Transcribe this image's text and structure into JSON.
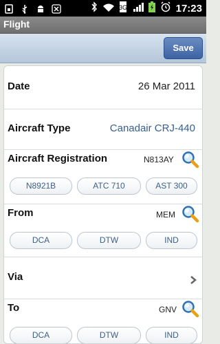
{
  "status_bar": {
    "time": "17:23",
    "icons": [
      "sim-icon",
      "usb-icon",
      "android-icon",
      "x-icon",
      "bluetooth-icon",
      "wifi-icon",
      "signal-icon",
      "battery-icon",
      "alarm-icon"
    ]
  },
  "title": "Flight",
  "toolbar": {
    "save_label": "Save"
  },
  "date": {
    "label": "Date",
    "value": "26 Mar 2011"
  },
  "aircraft_type": {
    "label": "Aircraft Type",
    "value": "Canadair CRJ-440"
  },
  "aircraft_registration": {
    "label": "Aircraft Registration",
    "value": "N813AY",
    "suggestions": [
      "N8921B",
      "ATC 710",
      "AST 300"
    ]
  },
  "from": {
    "label": "From",
    "value": "MEM",
    "suggestions": [
      "DCA",
      "DTW",
      "IND"
    ]
  },
  "via": {
    "label": "Via"
  },
  "to": {
    "label": "To",
    "value": "GNV",
    "suggestions": [
      "DCA",
      "DTW",
      "IND"
    ]
  },
  "colors": {
    "accent": "#3e63a4",
    "value_blue": "#365f8f",
    "chip_text": "#3d5f86"
  }
}
